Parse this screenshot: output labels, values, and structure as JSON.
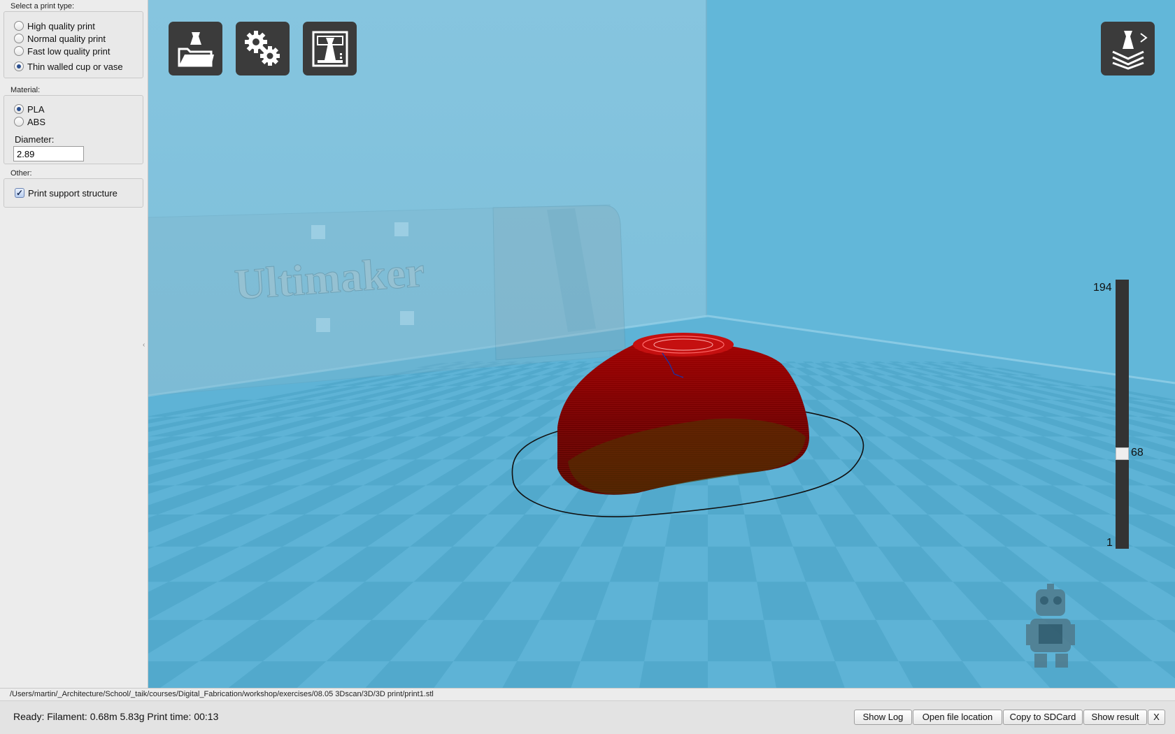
{
  "print_type": {
    "label": "Select a print type:",
    "options": [
      {
        "label": "High quality print",
        "selected": false
      },
      {
        "label": "Normal quality print",
        "selected": false
      },
      {
        "label": "Fast low quality print",
        "selected": false
      },
      {
        "label": "Thin walled cup or vase",
        "selected": true
      }
    ]
  },
  "material": {
    "label": "Material:",
    "options": [
      {
        "label": "PLA",
        "selected": true
      },
      {
        "label": "ABS",
        "selected": false
      }
    ],
    "diameter_label": "Diameter:",
    "diameter_value": "2.89"
  },
  "other": {
    "label": "Other:",
    "support_label": "Print support structure",
    "support_checked": true
  },
  "toolbar": {
    "buttons": [
      {
        "icon": "load-model-icon"
      },
      {
        "icon": "settings-gears-icon"
      },
      {
        "icon": "print-view-icon"
      },
      {
        "icon": "view-mode-layers-icon"
      }
    ]
  },
  "scene": {
    "wall_text": "Ultimaker",
    "colors": {
      "sky": "#62b7d9",
      "back_wall": "#8ac7e0",
      "floor_light": "#7cc6e4",
      "floor_dark": "#4fa6c9",
      "model": "#7a0000",
      "model_outline": "#111111"
    }
  },
  "layers": {
    "max": "194",
    "current": "68",
    "min": "1",
    "current_fraction": 0.345
  },
  "file_path": "/Users/martin/_Architecture/School/_taik/courses/Digital_Fabrication/workshop/exercises/08.05 3Dscan/3D/3D print/print1.stl",
  "status": {
    "text": "Ready: Filament: 0.68m 5.83g Print time: 00:13",
    "buttons": {
      "show_log": "Show Log",
      "open_location": "Open file location",
      "copy_sd": "Copy to SDCard",
      "show_result": "Show result",
      "close": "X"
    }
  }
}
